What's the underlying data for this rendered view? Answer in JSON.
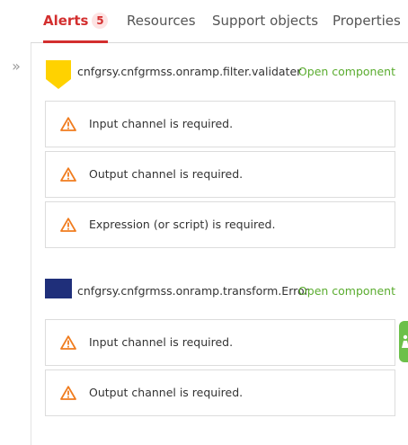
{
  "tabs": [
    {
      "label": "Alerts",
      "badge": "5",
      "active": true
    },
    {
      "label": "Resources"
    },
    {
      "label": "Support objects"
    },
    {
      "label": "Properties"
    }
  ],
  "sidebar": {
    "collapse_glyph": "»",
    "collapse_icon": "double-chevron-right-icon"
  },
  "components": [
    {
      "name": "cnfgrsy.cnfgrmss.onramp.filter.validater",
      "icon": "filter-icon",
      "icon_color": "#ffd200",
      "link": "Open component",
      "alerts": [
        "Input channel is required.",
        "Output channel is required.",
        "Expression (or script) is required."
      ]
    },
    {
      "name": "cnfgrsy.cnfgrmss.onramp.transform.Error",
      "icon": "transform-icon",
      "icon_color": "#1f2f7a",
      "link": "Open component",
      "alerts": [
        "Input channel is required.",
        "Output channel is required."
      ]
    }
  ],
  "colors": {
    "accent": "#d32f2f",
    "link": "#5aac2f",
    "warning": "#f07c1e",
    "float_button": "#6cc04a"
  }
}
